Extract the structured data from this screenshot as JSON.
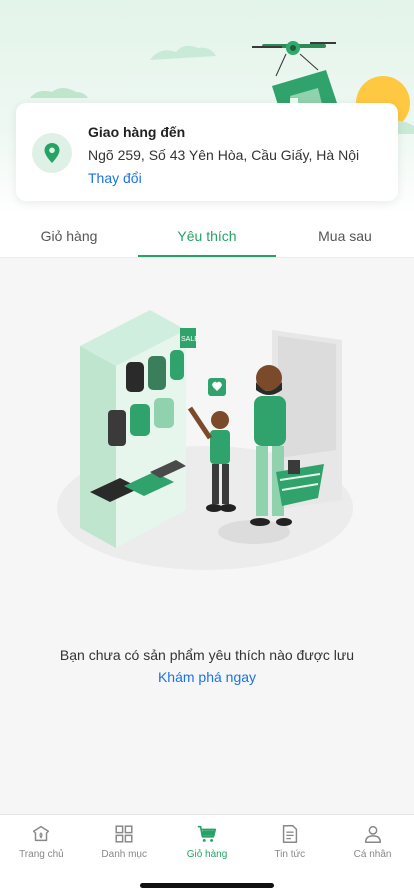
{
  "address": {
    "title": "Giao hàng đến",
    "line": "Ngõ 259, Số 43 Yên Hòa, Cầu Giấy, Hà Nội",
    "change_label": "Thay đổi"
  },
  "tabs": [
    {
      "label": "Giỏ hàng",
      "active": false
    },
    {
      "label": "Yêu thích",
      "active": true
    },
    {
      "label": "Mua sau",
      "active": false
    }
  ],
  "empty_state": {
    "message": "Bạn chưa có sản phẩm yêu thích nào được lưu",
    "link": "Khám phá ngay",
    "sale_tag": "SALE"
  },
  "bottom_nav": [
    {
      "label": "Trang chủ",
      "icon": "home-icon",
      "active": false
    },
    {
      "label": "Danh mục",
      "icon": "grid-icon",
      "active": false
    },
    {
      "label": "Giỏ hàng",
      "icon": "cart-icon",
      "active": true
    },
    {
      "label": "Tin tức",
      "icon": "news-icon",
      "active": false
    },
    {
      "label": "Cá nhân",
      "icon": "user-icon",
      "active": false
    }
  ],
  "colors": {
    "accent": "#25a366",
    "link": "#1a73e8"
  }
}
